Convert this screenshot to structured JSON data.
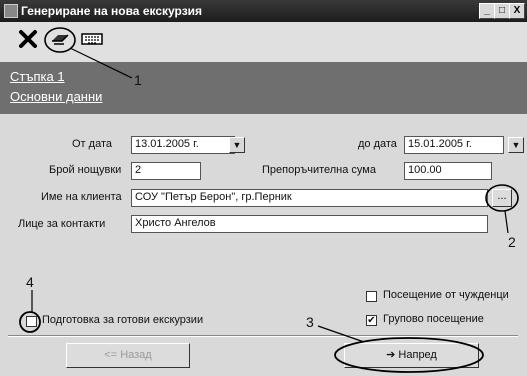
{
  "window": {
    "title": "Генериране на нова екскурзия"
  },
  "titlebar_buttons": [
    "_",
    "□",
    "X"
  ],
  "toolbar": {
    "icons": [
      "close-icon",
      "preview-icon",
      "keyboard-icon"
    ]
  },
  "step": {
    "title": "Стъпка 1",
    "subtitle": "Основни данни"
  },
  "form": {
    "from_date_label": "От дата",
    "from_date": "13.01.2005 г.",
    "to_date_label": "до дата",
    "to_date": "15.01.2005 г.",
    "nights_label": "Брой нощувки",
    "nights": "2",
    "recommended_sum_label": "Препоръчителна сума",
    "recommended_sum": "100.00",
    "client_label": "Име на клиента",
    "client": "СОУ \"Петър Берон\", гр.Перник",
    "contact_label": "Лице за контакти",
    "contact": "Христо Ангелов",
    "ellipsis": "..."
  },
  "options": {
    "foreign_label": "Посещение от чужденци",
    "foreign_checked": false,
    "group_label": "Групово посещение",
    "group_checked": true,
    "prep_label": "Подготовка за готови екскурзии",
    "prep_checked": false
  },
  "buttons": {
    "back": "Назад",
    "next": "Напред"
  },
  "annotations": {
    "a1": "1",
    "a2": "2",
    "a3": "3",
    "a4": "4"
  }
}
